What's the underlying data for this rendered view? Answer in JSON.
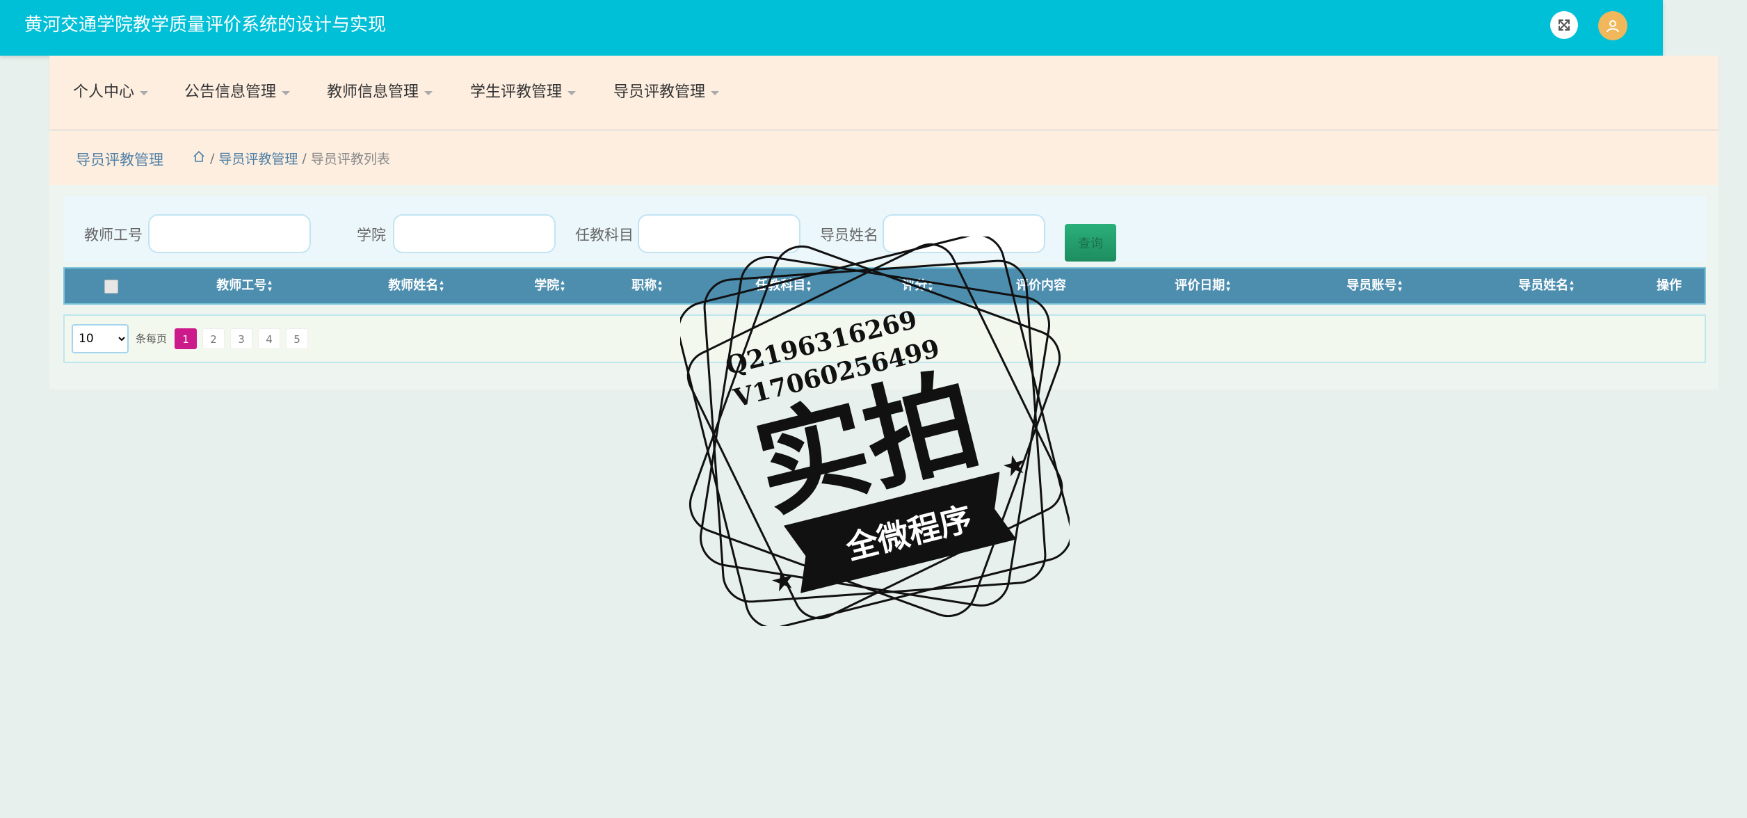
{
  "app": {
    "title": "黄河交通学院教学质量评价系统的设计与实现"
  },
  "header": {
    "fullscreen_icon": "expand-icon",
    "avatar_icon": "user-icon"
  },
  "nav": {
    "items": [
      {
        "label": "个人中心"
      },
      {
        "label": "公告信息管理"
      },
      {
        "label": "教师信息管理"
      },
      {
        "label": "学生评教管理"
      },
      {
        "label": "导员评教管理"
      }
    ]
  },
  "breadcrumb": {
    "title": "导员评教管理",
    "home_icon": "home-icon",
    "separator": "/",
    "items": [
      "导员评教管理",
      "导员评教列表"
    ]
  },
  "search": {
    "fields": [
      {
        "label": "教师工号",
        "value": ""
      },
      {
        "label": "学院",
        "value": ""
      },
      {
        "label": "任教科目",
        "value": ""
      },
      {
        "label": "导员姓名",
        "value": ""
      }
    ],
    "button_label": "查询"
  },
  "table": {
    "columns": [
      "教师工号",
      "教师姓名",
      "学院",
      "职称",
      "任教科目",
      "评分",
      "评价内容",
      "评价日期",
      "导员账号",
      "导员姓名",
      "操作"
    ],
    "rows": []
  },
  "pagination": {
    "page_size": "10",
    "page_size_options": [
      "10"
    ],
    "per_page_label": "条每页",
    "pages": [
      "1",
      "2",
      "3",
      "4",
      "5"
    ],
    "current_page": "1"
  },
  "watermark": {
    "lines": [
      "Q2196316269",
      "V17060256499"
    ],
    "main_text": "实拍",
    "banner_text": "全微程序"
  }
}
